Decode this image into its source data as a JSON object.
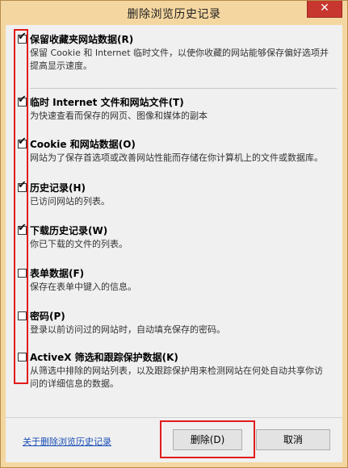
{
  "window": {
    "title": "删除浏览历史记录",
    "close_glyph": "✕"
  },
  "options": [
    {
      "label": "保留收藏夹网站数据(R)",
      "description": "保留 Cookie 和 Internet 临时文件，以使你收藏的网站能够保存偏好选项并提高显示速度。",
      "checked": true
    },
    {
      "label": "临时 Internet 文件和网站文件(T)",
      "description": "为快速查看而保存的网页、图像和媒体的副本",
      "checked": true
    },
    {
      "label": "Cookie 和网站数据(O)",
      "description": "网站为了保存首选项或改善网站性能而存储在你计算机上的文件或数据库。",
      "checked": true
    },
    {
      "label": "历史记录(H)",
      "description": "已访问网站的列表。",
      "checked": true
    },
    {
      "label": "下载历史记录(W)",
      "description": "你已下载的文件的列表。",
      "checked": true
    },
    {
      "label": "表单数据(F)",
      "description": "保存在表单中键入的信息。",
      "checked": false
    },
    {
      "label": "密码(P)",
      "description": "登录以前访问过的网站时，自动填充保存的密码。",
      "checked": false
    },
    {
      "label": "ActiveX 筛选和跟踪保护数据(K)",
      "description": "从筛选中排除的网站列表，以及跟踪保护用来检测网站在何处自动共享你访问的详细信息的数据。",
      "checked": false
    }
  ],
  "footer": {
    "help_link": "关于删除浏览历史记录",
    "delete_label": "删除(D)",
    "cancel_label": "取消"
  },
  "colors": {
    "frame": "#f4d6a0",
    "close": "#c7372f",
    "highlight": "#e21b1b",
    "link": "#1a4fb5"
  },
  "icons": {
    "check": "✔"
  }
}
